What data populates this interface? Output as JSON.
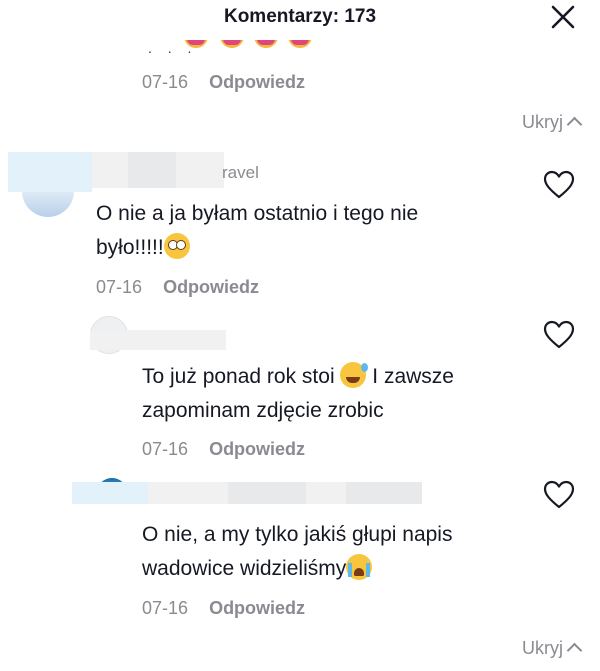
{
  "header": {
    "title": "Komentarzy: 173"
  },
  "prev_comment": {
    "date": "07-16",
    "reply_label": "Odpowiedz",
    "emoji_icons": [
      "grinning-emoji",
      "grinning-emoji",
      "grinning-emoji",
      "grinning-emoji"
    ]
  },
  "hide_replies_1": {
    "label": "Ukryj"
  },
  "comment_1": {
    "username_visible": "ravel",
    "text_line1": "O nie a ja byłam ostatnio i tego nie",
    "text_line2": "było!!!!!",
    "emoji_icon": "flushed-face-emoji",
    "date": "07-16",
    "reply_label": "Odpowiedz"
  },
  "reply_1": {
    "text_line1_a": "To już ponad rok stoi",
    "emoji_icon": "grinning-sweat-emoji",
    "text_line1_b": "I zawsze",
    "text_line2": "zapominam zdjęcie zrobic",
    "date": "07-16",
    "reply_label": "Odpowiedz"
  },
  "reply_2": {
    "text_line1": "O nie, a my tylko jakiś głupi napis",
    "text_line2": "wadowice widzieliśmy",
    "emoji_icon": "loudly-crying-emoji",
    "date": "07-16",
    "reply_label": "Odpowiedz"
  },
  "hide_replies_2": {
    "label": "Ukryj"
  },
  "colors": {
    "text": "#161823",
    "muted": "#8a8b91",
    "background": "#ffffff"
  }
}
